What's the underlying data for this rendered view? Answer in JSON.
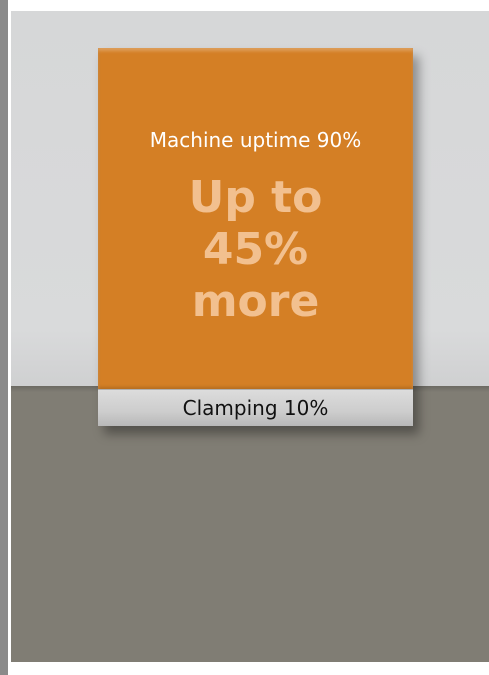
{
  "card": {
    "uptime_label": "Machine uptime 90%",
    "headline_lines": [
      "Up to",
      "45%",
      "more"
    ],
    "clamping_label": "Clamping 10%"
  },
  "colors": {
    "card_orange": "#d47f25",
    "headline_text": "#f2c08f",
    "background_upper": "#d9dadb",
    "background_lower": "#807d74"
  }
}
